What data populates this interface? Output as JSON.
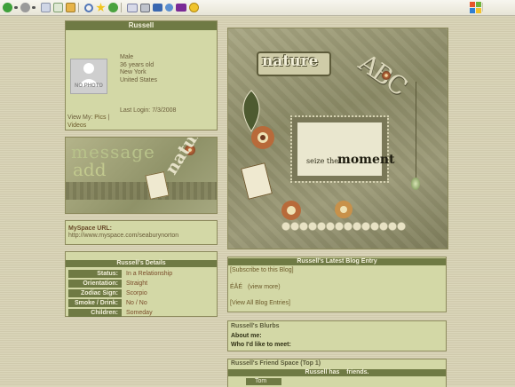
{
  "browser": {
    "toolbar_icons": [
      "back-icon",
      "forward-icon",
      "stop-icon",
      "refresh-icon",
      "home-icon",
      "search-icon",
      "favorites-icon",
      "history-icon",
      "mail-icon",
      "print-icon",
      "edit-icon",
      "messenger-icon",
      "yahoo-icon",
      "smiley-icon"
    ]
  },
  "profile": {
    "name": "Russell",
    "no_photo": "NO PHOTO",
    "gender": "Male",
    "age": "36 years old",
    "city": "New York",
    "country": "United States",
    "last_login": "Last Login: 7/3/2008",
    "view_my": "View My:",
    "pics": "Pics",
    "separator": "|",
    "videos": "Videos"
  },
  "add_banner": {
    "word1": "message",
    "word2": "add",
    "word3": "nature"
  },
  "url": {
    "label": "MySpace URL:",
    "value": "http://www.myspace.com/seaburynorton"
  },
  "details": {
    "title": "Russell's Details",
    "rows": [
      {
        "label": "Status:",
        "value": "In a Relationship"
      },
      {
        "label": "Orientation:",
        "value": "Straight"
      },
      {
        "label": "Zodiac Sign:",
        "value": "Scorpio"
      },
      {
        "label": "Smoke / Drink:",
        "value": "No / No"
      },
      {
        "label": "Children:",
        "value": "Someday"
      }
    ]
  },
  "banner": {
    "nature": "nature",
    "abc": "ABC",
    "seize": "seize the",
    "moment": "moment"
  },
  "blog": {
    "title": "Russell's Latest Blog Entry",
    "subscribe": "[Subscribe to this Blog]",
    "entry": "ÉÅÉ",
    "view_more": "(view more)",
    "view_all": "[View All Blog Entries]"
  },
  "blurbs": {
    "title": "Russell's Blurbs",
    "about": "About me:",
    "meet": "Who I'd like to meet:"
  },
  "friends": {
    "title": "Russell's Friend Space (Top 1)",
    "count_text": "Russell has    friends.",
    "friend": "Tom"
  },
  "colors": {
    "header_bg": "#6f7a44",
    "panel_bg": "#d3d8a6",
    "page_bg": "#d8d2b4"
  }
}
